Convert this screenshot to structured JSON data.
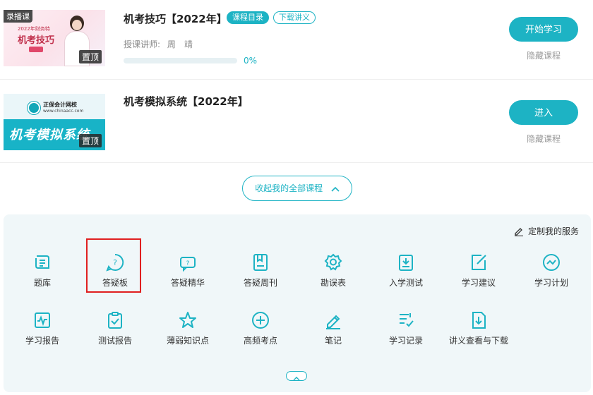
{
  "courses": [
    {
      "title": "机考技巧【2022年】",
      "tags": [
        "课程目录",
        "下载讲义"
      ],
      "teacher_label": "授课讲师:",
      "teacher_name": "周　靖",
      "progress_percent": 0,
      "progress_text": "0%",
      "primary_action": "开始学习",
      "hide_action": "隐藏课程",
      "thumbnail": {
        "tag": "录播课",
        "subtitle": "2022年财务特",
        "big_text": "机考技巧",
        "pin": "置顶"
      }
    },
    {
      "title": "机考模拟系统【2022年】",
      "primary_action": "进入",
      "hide_action": "隐藏课程",
      "thumbnail": {
        "school": "正保会计网校",
        "url": "www.chinaacc.com",
        "big_text": "机考模拟系统",
        "pin": "置顶"
      }
    }
  ],
  "collapse_button": "收起我的全部课程",
  "services": {
    "customize_label": "定制我的服务",
    "highlighted": "答疑板",
    "items": [
      {
        "label": "题库",
        "icon": "scroll-icon"
      },
      {
        "label": "答疑板",
        "icon": "question-bubble-icon"
      },
      {
        "label": "答疑精华",
        "icon": "chat-question-icon"
      },
      {
        "label": "答疑周刊",
        "icon": "book-bookmark-icon"
      },
      {
        "label": "勘误表",
        "icon": "gear-icon"
      },
      {
        "label": "入学测试",
        "icon": "clipboard-download-icon"
      },
      {
        "label": "学习建议",
        "icon": "edit-square-icon"
      },
      {
        "label": "学习计划",
        "icon": "trend-circle-icon"
      },
      {
        "label": "学习报告",
        "icon": "chart-screen-icon"
      },
      {
        "label": "测试报告",
        "icon": "clipboard-check-icon"
      },
      {
        "label": "薄弱知识点",
        "icon": "star-icon"
      },
      {
        "label": "高频考点",
        "icon": "plus-circle-icon"
      },
      {
        "label": "笔记",
        "icon": "pencil-note-icon"
      },
      {
        "label": "学习记录",
        "icon": "list-check-icon"
      },
      {
        "label": "讲义查看与下载",
        "icon": "file-download-icon"
      }
    ]
  },
  "colors": {
    "accent": "#1db3c4",
    "panel_bg": "#f0f7f9",
    "highlight_border": "#e02020"
  }
}
